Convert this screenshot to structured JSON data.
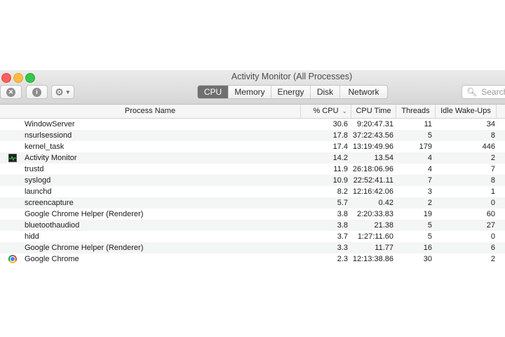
{
  "window": {
    "title": "Activity Monitor (All Processes)"
  },
  "toolbar": {
    "stop_icon": "stop-x-icon",
    "info_icon": "info-icon",
    "gear_icon": "gear-icon",
    "tabs": [
      "CPU",
      "Memory",
      "Energy",
      "Disk",
      "Network"
    ],
    "active_tab": "CPU",
    "search_placeholder": "Search"
  },
  "table": {
    "columns": [
      "Process Name",
      "% CPU",
      "CPU Time",
      "Threads",
      "Idle Wake-Ups"
    ],
    "sort_column": "% CPU",
    "rows": [
      {
        "name": "WindowServer",
        "cpu": "30.6",
        "time": "9:20:47.31",
        "threads": "11",
        "idle": "34",
        "icon": ""
      },
      {
        "name": "nsurlsessiond",
        "cpu": "17.8",
        "time": "37:22:43.56",
        "threads": "5",
        "idle": "8",
        "icon": ""
      },
      {
        "name": "kernel_task",
        "cpu": "17.4",
        "time": "13:19:49.96",
        "threads": "179",
        "idle": "446",
        "icon": ""
      },
      {
        "name": "Activity Monitor",
        "cpu": "14.2",
        "time": "13.54",
        "threads": "4",
        "idle": "2",
        "icon": "activity-monitor-icon"
      },
      {
        "name": "trustd",
        "cpu": "11.9",
        "time": "26:18:06.96",
        "threads": "4",
        "idle": "7",
        "icon": ""
      },
      {
        "name": "syslogd",
        "cpu": "10.9",
        "time": "22:52:41.11",
        "threads": "7",
        "idle": "8",
        "icon": ""
      },
      {
        "name": "launchd",
        "cpu": "8.2",
        "time": "12:16:42.06",
        "threads": "3",
        "idle": "1",
        "icon": ""
      },
      {
        "name": "screencapture",
        "cpu": "5.7",
        "time": "0.42",
        "threads": "2",
        "idle": "0",
        "icon": ""
      },
      {
        "name": "Google Chrome Helper (Renderer)",
        "cpu": "3.8",
        "time": "2:20:33.83",
        "threads": "19",
        "idle": "60",
        "icon": ""
      },
      {
        "name": "bluetoothaudiod",
        "cpu": "3.8",
        "time": "21.38",
        "threads": "5",
        "idle": "27",
        "icon": ""
      },
      {
        "name": "hidd",
        "cpu": "3.7",
        "time": "1:27:11.60",
        "threads": "5",
        "idle": "0",
        "icon": ""
      },
      {
        "name": "Google Chrome Helper (Renderer)",
        "cpu": "3.3",
        "time": "11.77",
        "threads": "16",
        "idle": "6",
        "icon": ""
      },
      {
        "name": "Google Chrome",
        "cpu": "2.3",
        "time": "12:13:38.86",
        "threads": "30",
        "idle": "2",
        "icon": "chrome-icon"
      }
    ]
  }
}
